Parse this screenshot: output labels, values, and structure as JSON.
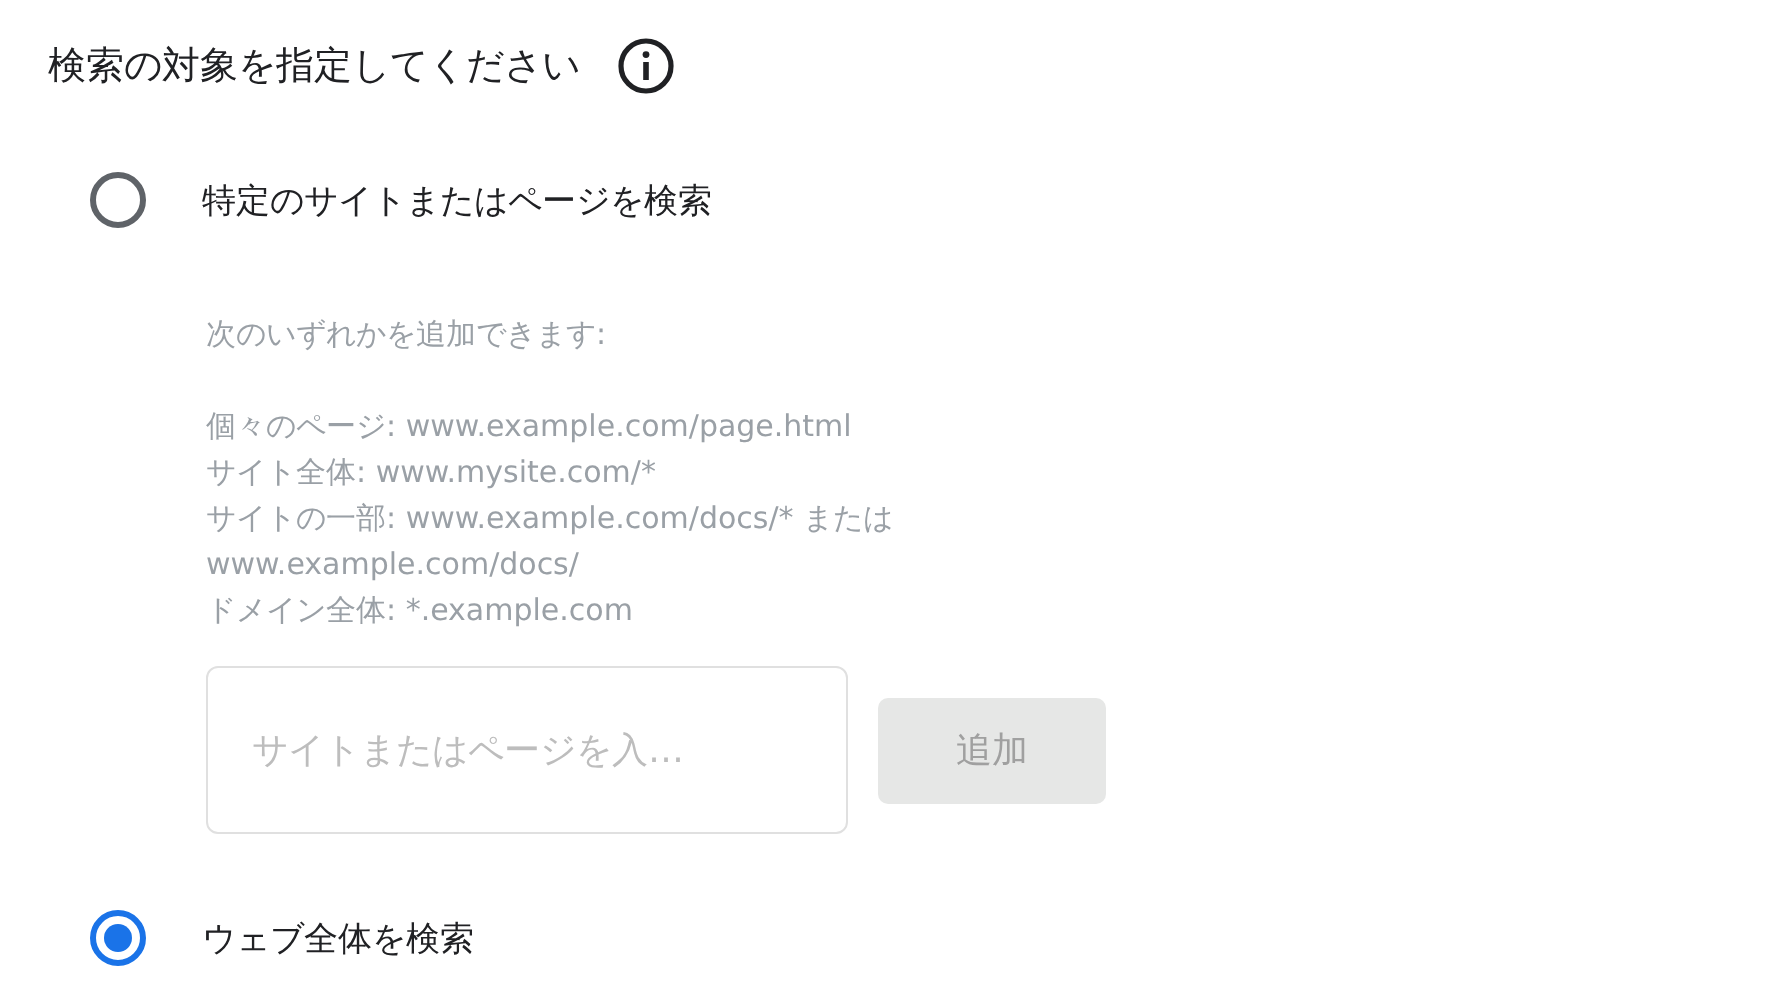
{
  "title": "検索の対象を指定してください",
  "options": [
    {
      "label": "特定のサイトまたはページを検索",
      "selected": false,
      "kind": "sites",
      "hint_intro": "次のいずれかを追加できます:",
      "hint_lines": [
        "個々のページ: www.example.com/page.html",
        "サイト全体: www.mysite.com/*",
        "サイトの一部: www.example.com/docs/* または",
        "www.example.com/docs/",
        "ドメイン全体: *.example.com"
      ],
      "input": {
        "placeholder": "サイトまたはページを入…"
      },
      "add_button": {
        "label": "追加",
        "disabled": true
      }
    },
    {
      "label": "ウェブ全体を検索",
      "selected": true,
      "kind": "plain"
    }
  ]
}
